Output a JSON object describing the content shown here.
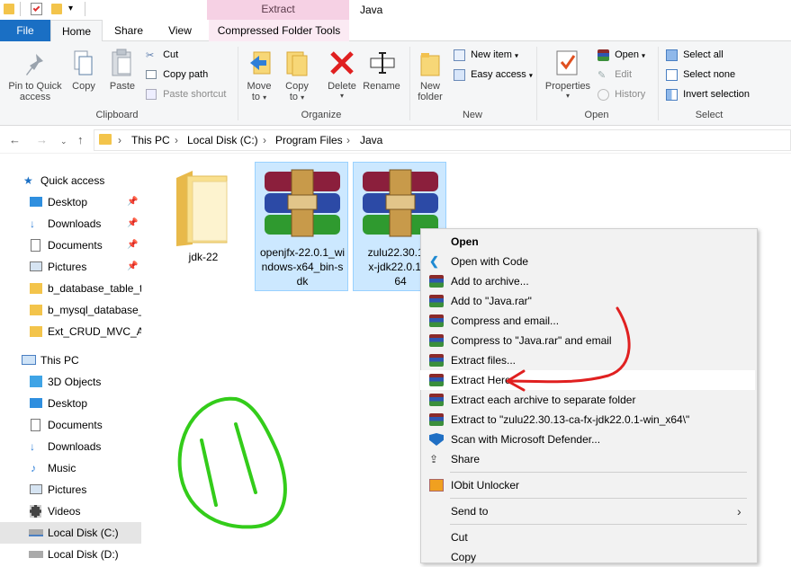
{
  "window": {
    "title": "Java",
    "contextual_tab_group": "Extract"
  },
  "ribbon_tabs": [
    "File",
    "Home",
    "Share",
    "View",
    "Compressed Folder Tools"
  ],
  "ribbon": {
    "clipboard": {
      "label": "Clipboard",
      "pin_to_quick_access": "Pin to Quick access",
      "pin_line1": "Pin to Quick",
      "pin_line2": "access",
      "copy": "Copy",
      "paste": "Paste",
      "cut": "Cut",
      "copy_path": "Copy path",
      "paste_shortcut": "Paste shortcut"
    },
    "organize": {
      "label": "Organize",
      "move_to": "Move",
      "move_to2": "to",
      "copy_to": "Copy",
      "copy_to2": "to",
      "delete": "Delete",
      "rename": "Rename"
    },
    "new": {
      "label": "New",
      "new_folder1": "New",
      "new_folder2": "folder",
      "new_item": "New item",
      "easy_access": "Easy access"
    },
    "open": {
      "label": "Open",
      "properties": "Properties",
      "open": "Open",
      "edit": "Edit",
      "history": "History"
    },
    "select": {
      "label": "Select",
      "select_all": "Select all",
      "select_none": "Select none",
      "invert_selection": "Invert selection"
    }
  },
  "address_bar": {
    "breadcrumbs": [
      "This PC",
      "Local Disk (C:)",
      "Program Files",
      "Java"
    ]
  },
  "nav_pane": {
    "quick_access": "Quick access",
    "quick_items": [
      "Desktop",
      "Downloads",
      "Documents",
      "Pictures",
      "b_database_table_to",
      "b_mysql_database_t",
      "Ext_CRUD_MVC_AS"
    ],
    "this_pc": "This PC",
    "pc_items": [
      "3D Objects",
      "Desktop",
      "Documents",
      "Downloads",
      "Music",
      "Pictures",
      "Videos",
      "Local Disk (C:)",
      "Local Disk (D:)"
    ]
  },
  "files": [
    {
      "name_lines": [
        "jdk-22"
      ],
      "type": "folder"
    },
    {
      "name_lines": [
        "openjfx-22.0.1_wi",
        "ndows-x64_bin-s",
        "dk"
      ],
      "type": "archive"
    },
    {
      "name_lines": [
        "zulu22.30.13-",
        "x-jdk22.0.1-w",
        "64"
      ],
      "type": "archive"
    }
  ],
  "context_menu": {
    "items": [
      "Open",
      "Open with Code",
      "Add to archive...",
      "Add to \"Java.rar\"",
      "Compress and email...",
      "Compress to \"Java.rar\" and email",
      "Extract files...",
      "Extract Here",
      "Extract each archive to separate folder",
      "Extract to \"zulu22.30.13-ca-fx-jdk22.0.1-win_x64\\\"",
      "Scan with Microsoft Defender...",
      "Share",
      "IObit Unlocker",
      "Send to",
      "Cut",
      "Copy"
    ],
    "highlighted": "Extract Here"
  },
  "colors": {
    "file_tab": "#1a6fc4",
    "contextual_tab": "#f6d1e4",
    "selection": "#cce8ff",
    "annotation_red": "#e02020",
    "annotation_green": "#33cc1a"
  }
}
